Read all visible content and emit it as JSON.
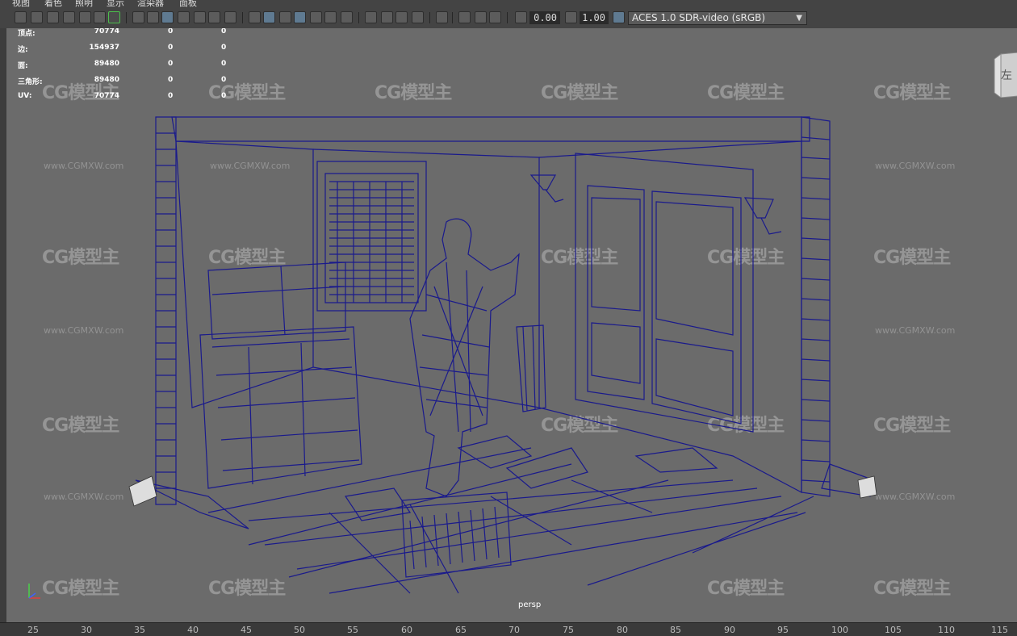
{
  "menu": {
    "items": [
      "视图",
      "着色",
      "照明",
      "显示",
      "渲染器",
      "面板"
    ]
  },
  "toolbar": {
    "exposure_value": "0.00",
    "gamma_value": "1.00",
    "colorspace_label": "ACES 1.0 SDR-video (sRGB)"
  },
  "hud": {
    "rows": [
      {
        "label": "顶点:",
        "v1": "70774",
        "v2": "0",
        "v3": "0"
      },
      {
        "label": "边:",
        "v1": "154937",
        "v2": "0",
        "v3": "0"
      },
      {
        "label": "面:",
        "v1": "89480",
        "v2": "0",
        "v3": "0"
      },
      {
        "label": "三角形:",
        "v1": "89480",
        "v2": "0",
        "v3": "0"
      },
      {
        "label": "UV:",
        "v1": "70774",
        "v2": "0",
        "v3": "0"
      }
    ]
  },
  "viewport": {
    "camera_label": "persp",
    "viewcube_face": "左",
    "watermark_logo": "CG模型主",
    "watermark_url": "www.CGMXW.com",
    "wireframe_color": "#1a1a8c"
  },
  "timeline": {
    "ticks": [
      "25",
      "30",
      "35",
      "40",
      "45",
      "50",
      "55",
      "60",
      "65",
      "70",
      "75",
      "80",
      "85",
      "90",
      "95",
      "100",
      "105",
      "110",
      "115"
    ]
  }
}
